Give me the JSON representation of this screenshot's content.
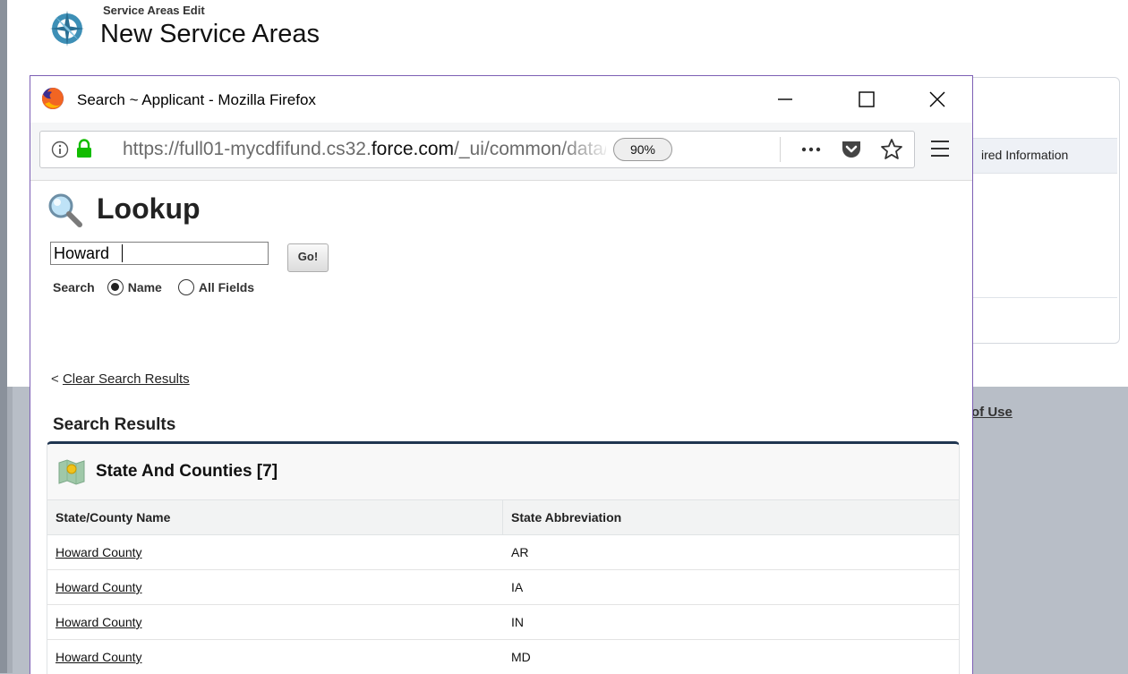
{
  "background_page": {
    "subtitle": "Service Areas Edit",
    "title": "New Service Areas",
    "panel_bar_text": "ired Information",
    "footer_link": "of Use"
  },
  "popup": {
    "window_title": "Search ~ Applicant - Mozilla Firefox",
    "url_prefix": "https://full01-mycdfifund.cs32.",
    "url_domain": "force.com",
    "url_suffix": "/_ui/common/data/LookupPage",
    "zoom": "90%",
    "icons": [
      "firefox-icon",
      "minimize-icon",
      "maximize-icon",
      "close-icon",
      "info-icon",
      "lock-icon",
      "more-actions-icon",
      "pocket-icon",
      "star-icon",
      "menu-icon",
      "magnifier-icon",
      "map-icon"
    ]
  },
  "lookup": {
    "title": "Lookup",
    "search_value": "Howard",
    "go_label": "Go!",
    "search_label": "Search",
    "option_name": "Name",
    "option_all": "All Fields",
    "selected_option": "Name",
    "clear_prefix": "<",
    "clear_link": "Clear Search Results",
    "results_heading": "Search Results",
    "block_title": "State And Counties [7]",
    "columns": [
      "State/County Name",
      "State Abbreviation"
    ],
    "rows": [
      {
        "name": "Howard County",
        "abbr": "AR"
      },
      {
        "name": "Howard County",
        "abbr": "IA"
      },
      {
        "name": "Howard County",
        "abbr": "IN"
      },
      {
        "name": "Howard County",
        "abbr": "MD"
      }
    ]
  }
}
